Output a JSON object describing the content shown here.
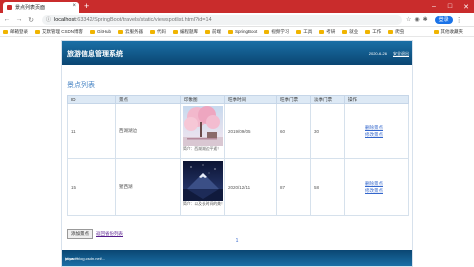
{
  "browser": {
    "tab_title": "景点列表页面",
    "url_host": "localhost",
    "url_path": ":63342/SpringBoot/travels/static/viewspotlist.html?id=14",
    "sync_label": "登录",
    "bookmarks": [
      "邮箱登录",
      "艾默管理 CSDN博客",
      "GitHub",
      "云服务器",
      "代码",
      "编程题库",
      "前端",
      "SpringBoot",
      "视频学习",
      "工具",
      "考研",
      "就业",
      "工作",
      "爬虫"
    ],
    "bookmarks_right": "其他收藏夹"
  },
  "app": {
    "title": "旅游信息管理系统",
    "date": "2020-6-26",
    "logout": "安全退出",
    "section_title": "景点列表",
    "columns": [
      "ID",
      "景点",
      "印象图",
      "旺季时间",
      "旺季门票",
      "淡季门票",
      "操作"
    ],
    "rows": [
      {
        "id": "11",
        "name": "西湖湖边",
        "caption": "简介：西湖湖边平遥！",
        "season": "2019/09/05",
        "peak_price": "60",
        "off_price": "30",
        "delete": "删除景点",
        "edit": "修改景点"
      },
      {
        "id": "15",
        "name": "猩西湖",
        "caption": "简介：以及长时间的美！",
        "season": "2020/12/11",
        "peak_price": "87",
        "off_price": "58",
        "delete": "删除景点",
        "edit": "修改景点"
      }
    ],
    "add_button": "添加景点",
    "back_link": "返回省份列表",
    "page_number": "1",
    "footer_text": "yusan~",
    "watermark": "https://blog.csdn.net/..."
  }
}
